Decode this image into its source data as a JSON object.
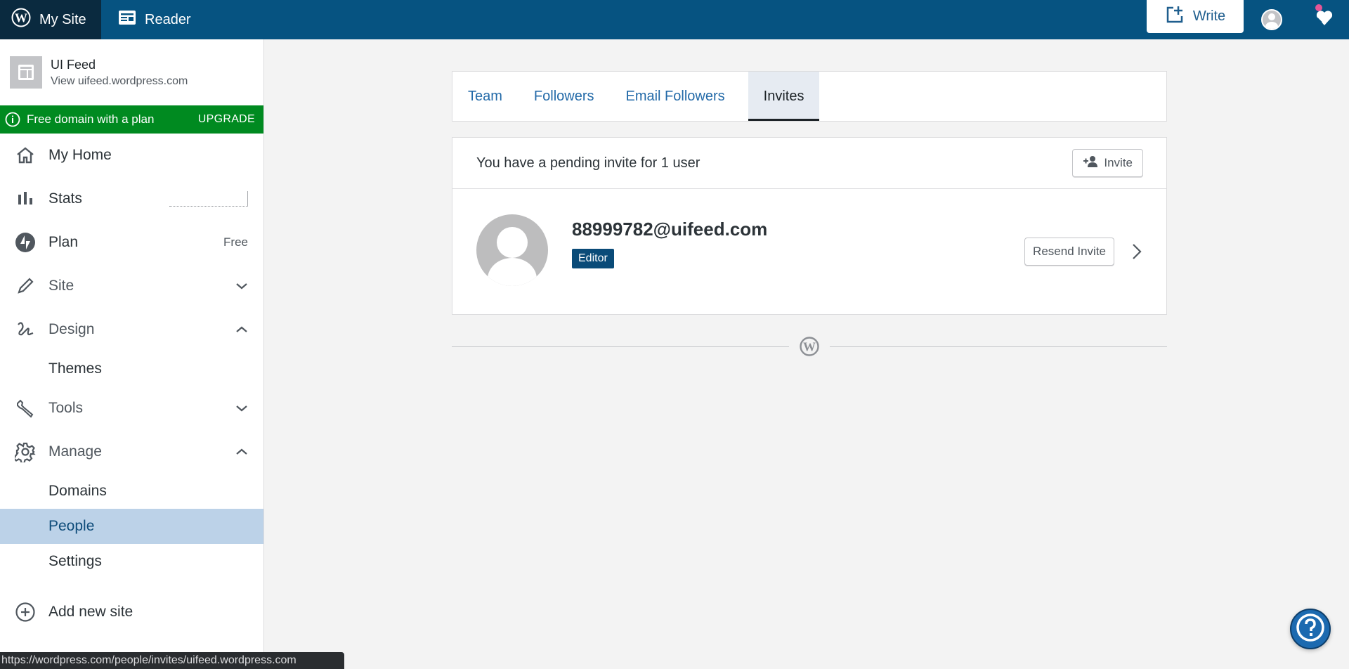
{
  "masterbar": {
    "my_site_label": "My Site",
    "reader_label": "Reader",
    "write_label": "Write"
  },
  "sidebar": {
    "site_name": "UI Feed",
    "site_url": "View uifeed.wordpress.com",
    "upsell_text": "Free domain with a plan",
    "upsell_cta": "UPGRADE",
    "items": {
      "my_home": "My Home",
      "stats": "Stats",
      "plan": "Plan",
      "plan_badge": "Free",
      "site": "Site",
      "design": "Design",
      "themes": "Themes",
      "tools": "Tools",
      "manage": "Manage",
      "domains": "Domains",
      "people": "People",
      "settings": "Settings",
      "add_new_site": "Add new site"
    }
  },
  "status_url": "https://wordpress.com/people/invites/uifeed.wordpress.com",
  "tabs": [
    {
      "label": "Team"
    },
    {
      "label": "Followers"
    },
    {
      "label": "Email Followers"
    },
    {
      "label": "Invites",
      "active": true
    }
  ],
  "invites": {
    "summary": "You have a pending invite for 1 user",
    "invite_button": "Invite",
    "rows": [
      {
        "email": "88999782@uifeed.com",
        "role": "Editor",
        "action": "Resend Invite"
      }
    ]
  },
  "colors": {
    "masterbar": "#065381",
    "masterbar_active": "#0a2a3f",
    "upsell_green": "#008a20",
    "sidebar_active": "#bcd2e8",
    "badge": "#0a4b78",
    "help": "#1c6ab0"
  }
}
